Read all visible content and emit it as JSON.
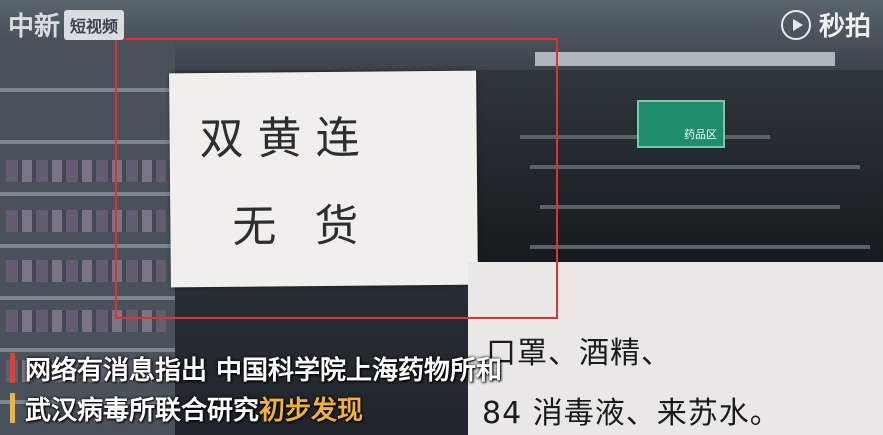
{
  "watermark": {
    "left_brand": "中新",
    "left_tag": "短视频",
    "right_icon": "play-circle-icon",
    "right_name": "秒拍"
  },
  "sign": {
    "line1": "双黄连",
    "line2": "无货"
  },
  "store_sign": {
    "text": "药品区"
  },
  "notice": {
    "line1": "口罩、酒精、",
    "line2": "84 消毒液、来苏水。"
  },
  "subtitle": {
    "line1": "网络有消息指出 中国科学院上海药物所和",
    "line2_plain": "武汉病毒所联合研究",
    "line2_highlight": "初步发现",
    "bar_colors": [
      "#e2412f",
      "#f2b13a"
    ]
  },
  "highlight_color": "#e0322e"
}
